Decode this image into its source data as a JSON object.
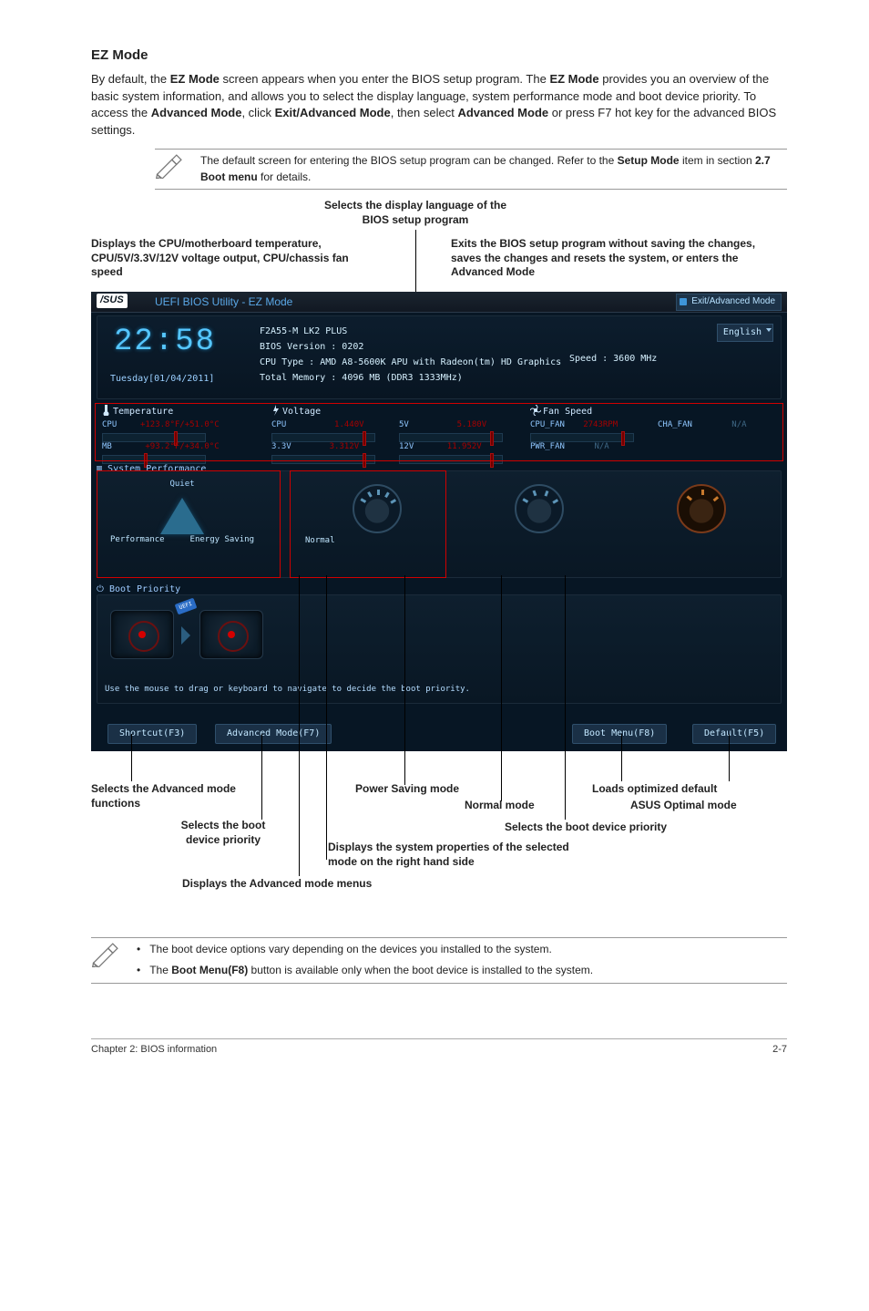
{
  "heading": "EZ Mode",
  "intro_html": "By default, the <b>EZ Mode</b> screen appears when you enter the BIOS setup program. The <b>EZ Mode</b> provides you an overview of the basic system information, and allows you to select the display language, system performance mode and boot device priority. To access the <b>Advanced Mode</b>, click <b>Exit/Advanced Mode</b>, then select <b>Advanced Mode</b> or press F7 hot key for the advanced BIOS settings.",
  "note1_html": "The default screen for entering the BIOS setup program can be changed. Refer to the <b>Setup Mode</b> item in section <b>2.7 Boot menu</b> for details.",
  "callouts": {
    "lang": "Selects the display language of the BIOS setup program",
    "temp": "Displays the CPU/motherboard temperature, CPU/5V/3.3V/12V voltage output, CPU/chassis fan speed",
    "exit": "Exits the BIOS setup program without saving the changes, saves the changes and resets the system, or enters the Advanced Mode",
    "advfn": "Selects the Advanced mode functions",
    "pwr": "Power Saving mode",
    "normal": "Normal mode",
    "load": "Loads optimized default",
    "asus": "ASUS Optimal mode",
    "bootsel": "Selects the boot device priority",
    "bootprio": "Selects the boot device priority",
    "sysprop": "Displays the system properties of the selected mode on the right hand side",
    "advmenu": "Displays the Advanced mode menus"
  },
  "bios": {
    "brand": "/SUS",
    "util": "UEFI BIOS Utility - EZ Mode",
    "exitBtn": "Exit/Advanced Mode",
    "clock": "22:58",
    "date": "Tuesday[01/04/2011]",
    "model": "F2A55-M LK2 PLUS",
    "ver": "BIOS Version : 0202",
    "cpu": "CPU Type : AMD A8-5600K APU with Radeon(tm) HD Graphics",
    "mem": "Total Memory : 4096 MB (DDR3 1333MHz)",
    "speed": "Speed : 3600 MHz",
    "lang": "English",
    "hdrs": {
      "temp": "Temperature",
      "volt": "Voltage",
      "fan": "Fan Speed"
    },
    "temp": {
      "cpu": [
        "CPU",
        "+123.8°F/+51.0°C"
      ],
      "mb": [
        "MB",
        "+93.2°F/+34.0°C"
      ]
    },
    "volt": {
      "cpu": [
        "CPU",
        "1.440V"
      ],
      "v5": [
        "5V",
        "5.180V"
      ],
      "v33": [
        "3.3V",
        "3.312V"
      ],
      "v12": [
        "12V",
        "11.952V"
      ]
    },
    "fan": {
      "cpu": [
        "CPU_FAN",
        "2743RPM"
      ],
      "cha": [
        "CHA_FAN",
        "N/A"
      ],
      "pwr": [
        "PWR_FAN",
        "N/A"
      ]
    },
    "sysperf": "System Performance",
    "modes": {
      "quiet": "Quiet",
      "perf": "Performance",
      "energy": "Energy Saving",
      "normal": "Normal"
    },
    "bootprio": "Boot Priority",
    "hint": "Use the mouse to drag or keyboard to navigate to decide the boot priority.",
    "uefi": "UEFI",
    "btns": {
      "shortcut": "Shortcut(F3)",
      "adv": "Advanced Mode(F7)",
      "bootmenu": "Boot Menu(F8)",
      "def": "Default(F5)"
    }
  },
  "notes2": [
    "The boot device options vary depending on the devices you installed to the system.",
    "The <b>Boot Menu(F8)</b> button is available only when the boot device is installed to the system."
  ],
  "footer": {
    "left": "Chapter 2: BIOS information",
    "right": "2-7"
  }
}
